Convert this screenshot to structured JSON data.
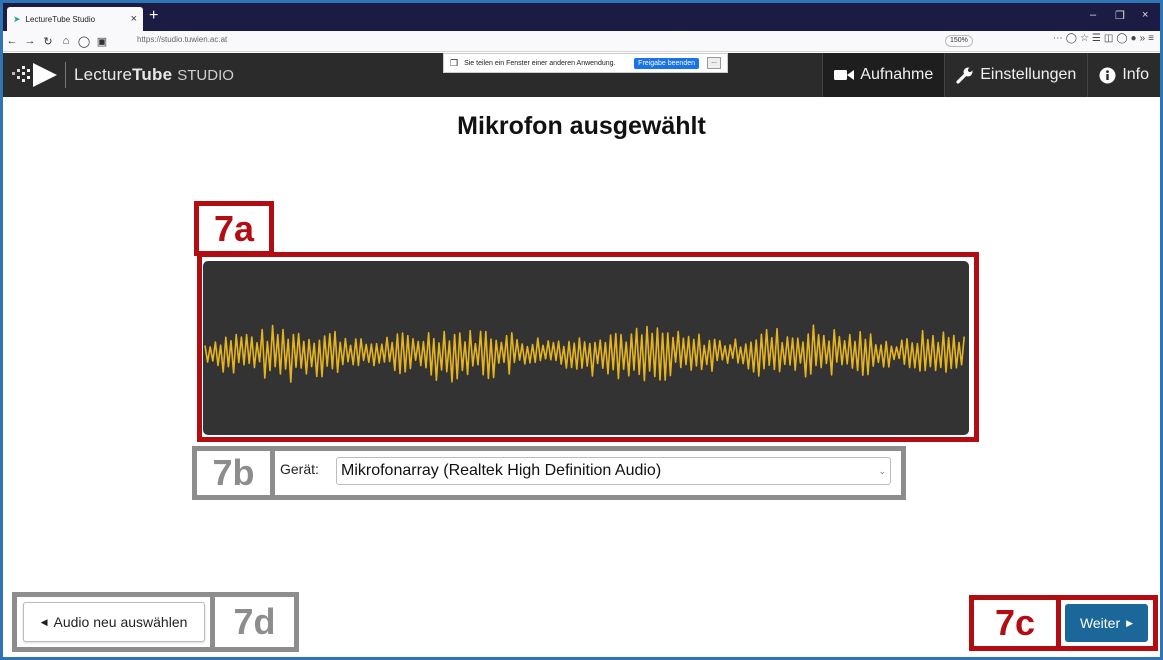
{
  "browser": {
    "tab_title": "LectureTube Studio",
    "url": "https://studio.tuwien.ac.at",
    "zoom": "150%"
  },
  "share_bar": {
    "message": "Sie teilen ein Fenster einer anderen Anwendung.",
    "stop_label": "Freigabe beenden",
    "minimize_label": "..."
  },
  "app": {
    "brand_light": "Lecture",
    "brand_bold": "Tube",
    "brand_suffix": "STUDIO",
    "nav": [
      {
        "label": "Aufnahme",
        "icon": "video-camera-icon",
        "active": true
      },
      {
        "label": "Einstellungen",
        "icon": "wrench-icon",
        "active": false
      },
      {
        "label": "Info",
        "icon": "info-icon",
        "active": false
      }
    ]
  },
  "page": {
    "title": "Mikrofon ausgewählt",
    "device_label": "Gerät:",
    "device_value": "Mikrofonarray (Realtek High Definition Audio)",
    "back_label": "Audio neu auswählen",
    "next_label": "Weiter"
  },
  "annotations": {
    "a": "7a",
    "b": "7b",
    "c": "7c",
    "d": "7d"
  },
  "colors": {
    "accent_red": "#b30d14",
    "accent_gray": "#8d8d8d",
    "waveform": "#e6b41e",
    "primary_button": "#1b6799",
    "header_bg": "#2b2b2b"
  }
}
